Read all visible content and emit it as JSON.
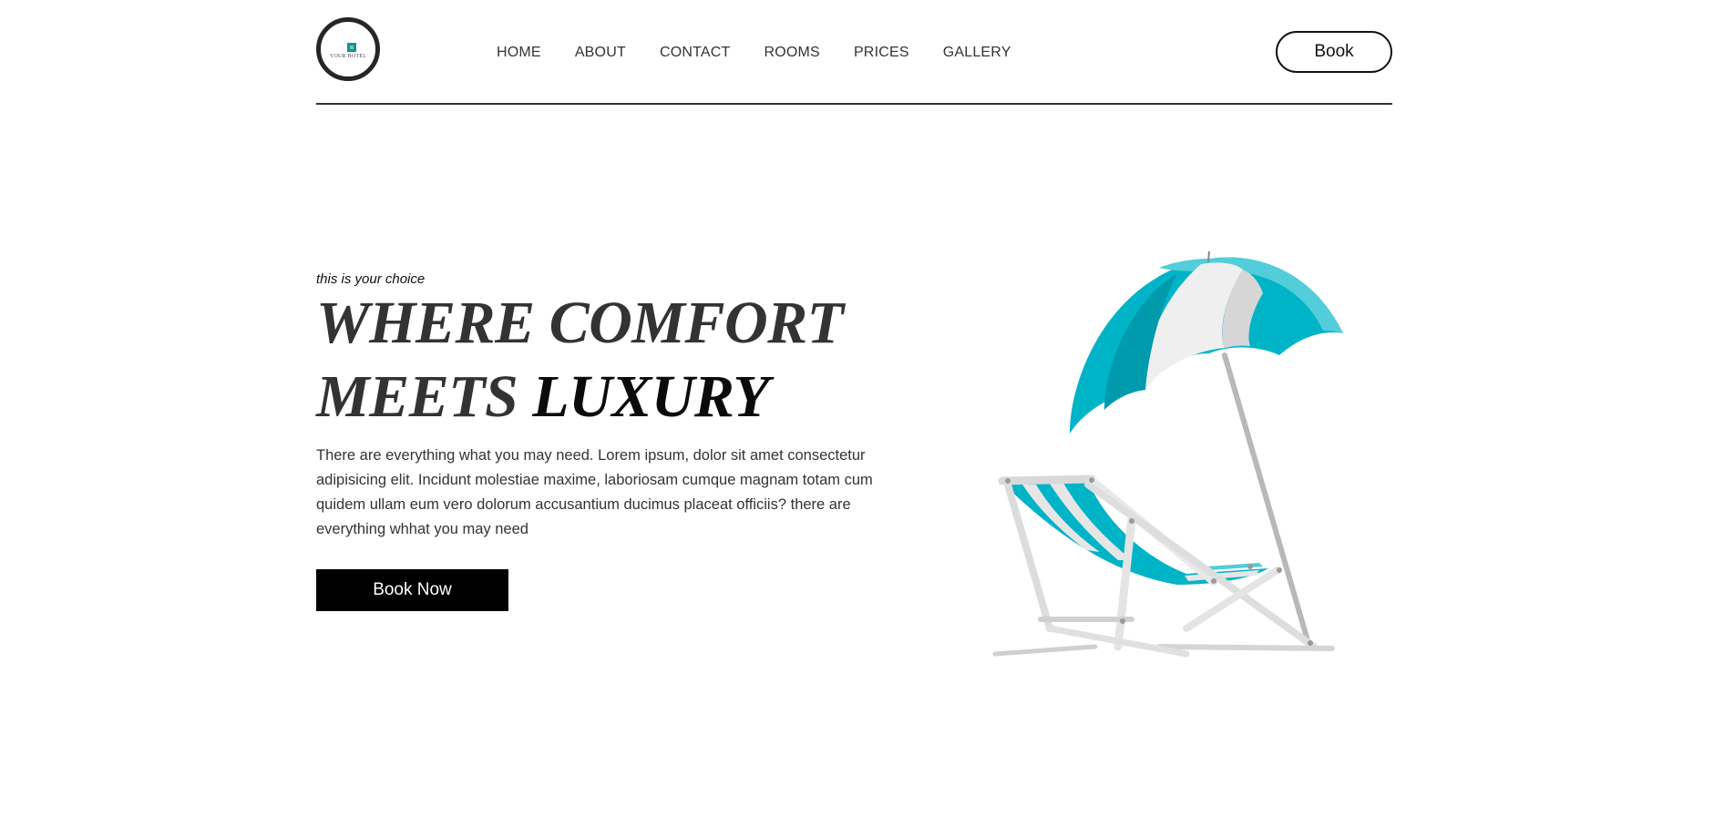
{
  "header": {
    "logo_text": "YOUR HOTEL",
    "nav": [
      "HOME",
      "ABOUT",
      "CONTACT",
      "ROOMS",
      "PRICES",
      "GALLERY"
    ],
    "book_label": "Book"
  },
  "hero": {
    "tagline": "this is your choice",
    "headline_line1": "WHERE COMFORT",
    "headline_line2": "MEETS",
    "headline_accent": "LUXURY",
    "description": "There are everything what you may need. Lorem ipsum, dolor sit amet consectetur adipisicing elit. Incidunt molestiae maxime, laboriosam cumque magnam totam cum quidem ullam eum vero dolorum accusantium ducimus placeat officiis? there are everything whhat you may need",
    "cta_label": "Book Now"
  },
  "colors": {
    "accent": "#00b4c8",
    "text": "#333333",
    "button_bg": "#000000"
  },
  "icons": {
    "illustration": "beach-chair-umbrella-illustration"
  }
}
